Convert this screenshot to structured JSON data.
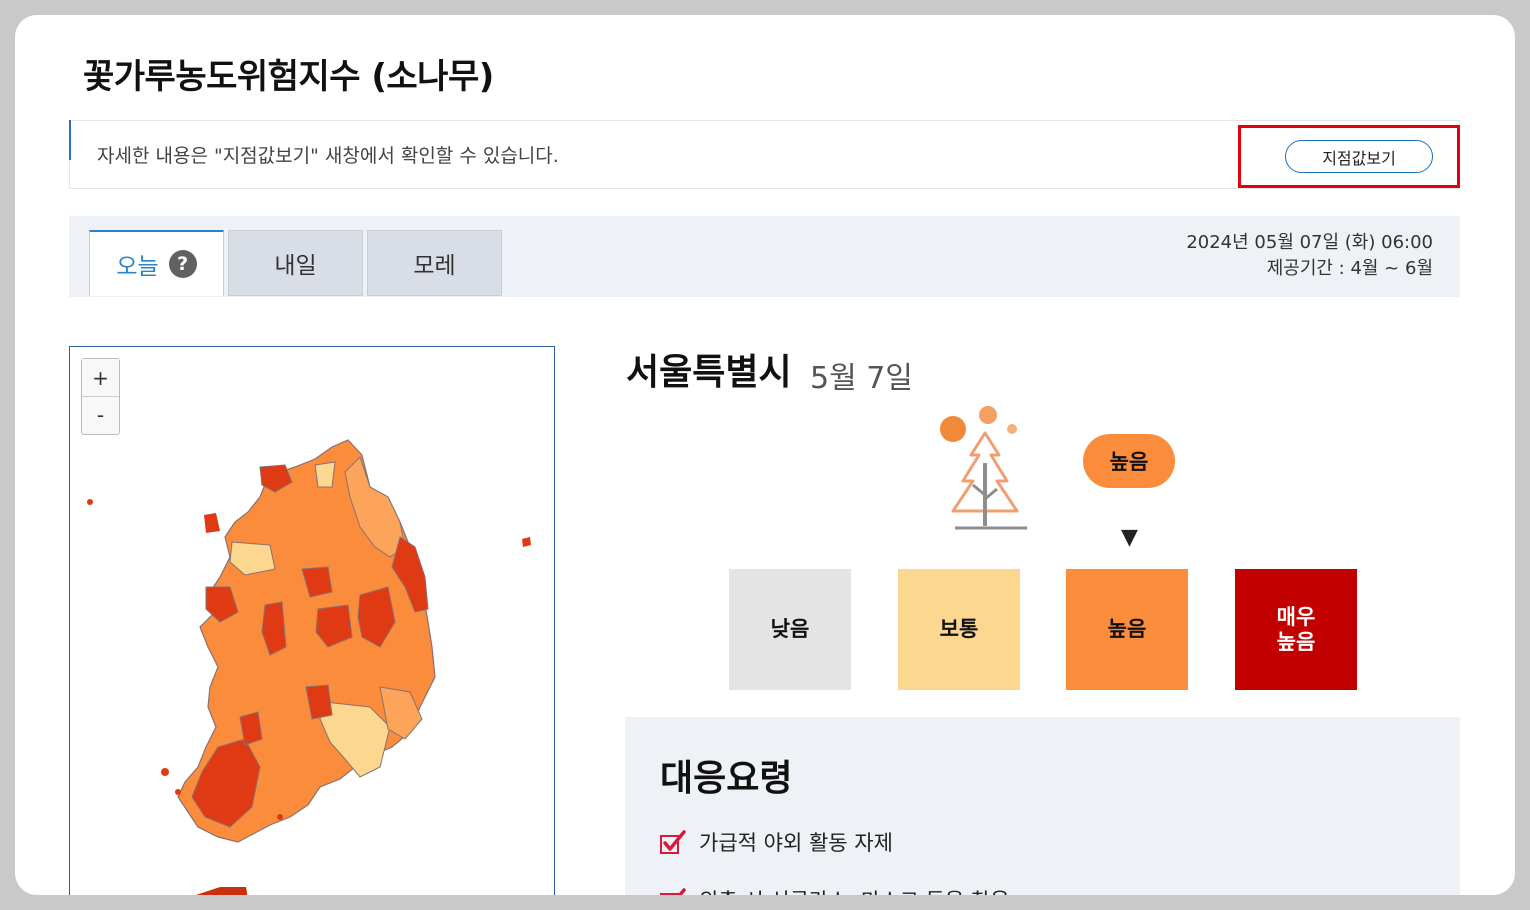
{
  "page": {
    "title": "꽃가루농도위험지수 (소나무)"
  },
  "notice": {
    "text": "자세한 내용은 \"지점값보기\" 새창에서 확인할 수 있습니다.",
    "button_label": "지점값보기"
  },
  "tabs": [
    {
      "label": "오늘",
      "active": true
    },
    {
      "label": "내일",
      "active": false
    },
    {
      "label": "모레",
      "active": false
    }
  ],
  "help_icon": {
    "glyph": "?"
  },
  "datetime": {
    "current": "2024년 05월 07일 (화) 06:00",
    "period": "제공기간 : 4월 ~ 6월"
  },
  "map": {
    "zoom_in": "+",
    "zoom_out": "-"
  },
  "region": {
    "name": "서울특별시",
    "date": "5월 7일"
  },
  "current_level": {
    "label": "높음",
    "index": 2,
    "pointer": "▼"
  },
  "levels": [
    {
      "label": "낮음",
      "color": "#e4e4e4",
      "text_color": "#111111"
    },
    {
      "label": "보통",
      "color": "#fbd78f",
      "text_color": "#111111"
    },
    {
      "label": "높음",
      "color": "#fb8c3c",
      "text_color": "#111111"
    },
    {
      "label": "매우\n높음",
      "color": "#c30000",
      "text_color": "#ffffff"
    }
  ],
  "guide": {
    "title": "대응요령",
    "items": [
      "가급적 야외 활동 자제",
      "외출 시 선글라스, 마스크 등을 착용"
    ]
  },
  "colors": {
    "accent_blue": "#2a84c7",
    "highlight_red": "#e00010",
    "map_high": "#fb8c3c",
    "map_very_high": "#e03a14",
    "map_moderate": "#fbd78f",
    "map_border": "#7a7a8a"
  }
}
